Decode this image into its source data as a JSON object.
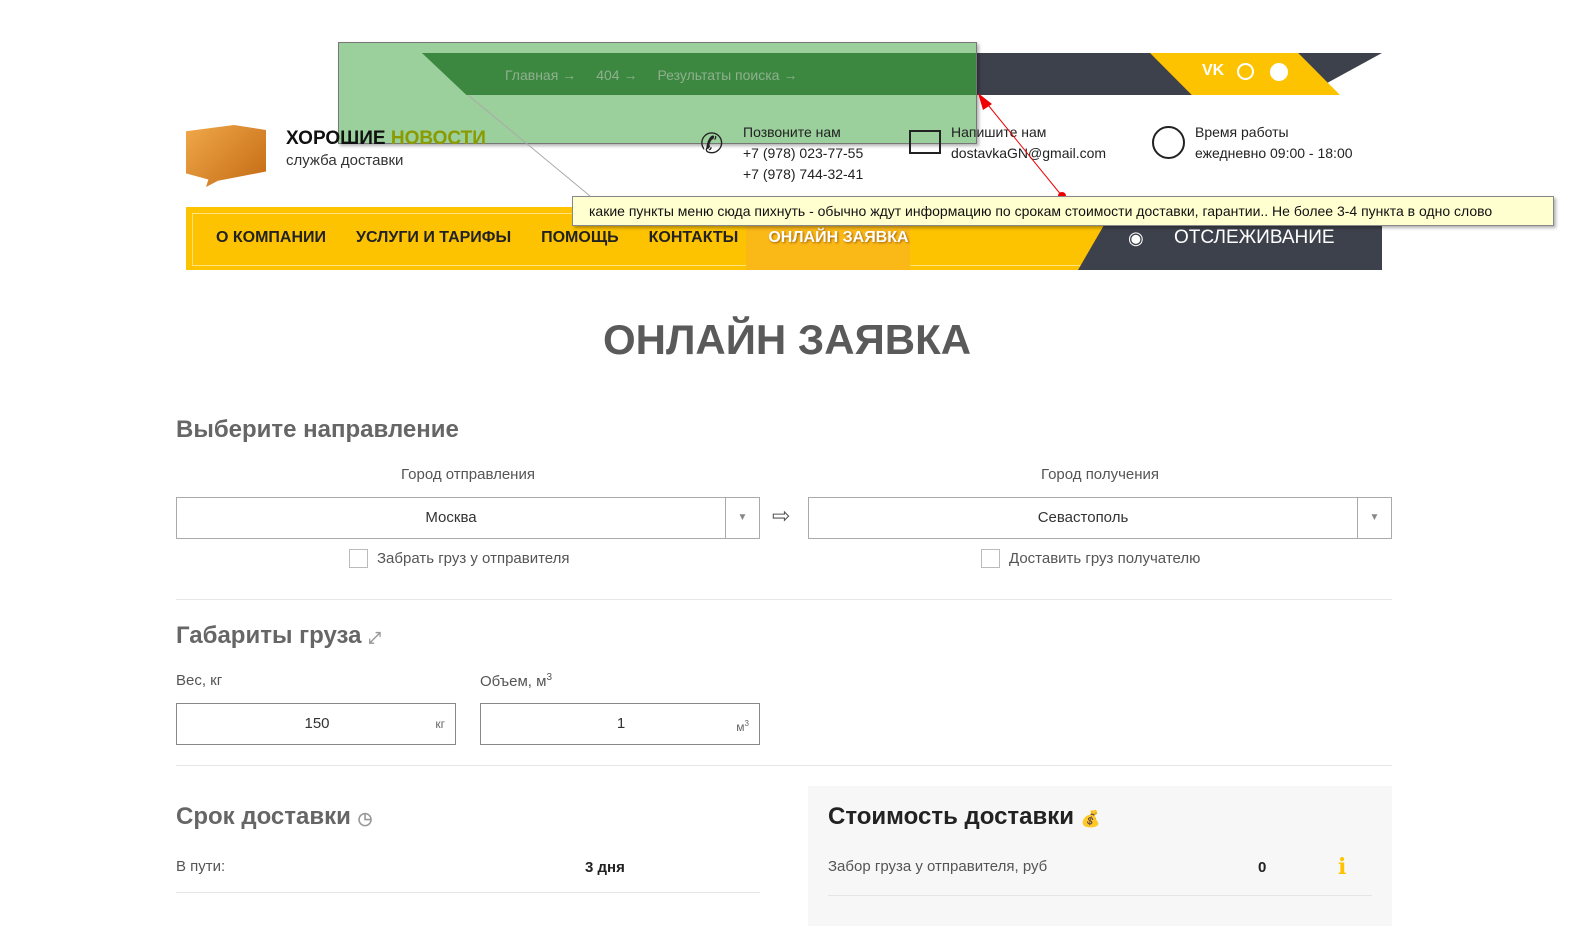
{
  "breadcrumb": [
    "Главная →",
    "404 →",
    "Результаты поиска →"
  ],
  "social": [
    "VK",
    "WA",
    "TG"
  ],
  "logo": {
    "title_a": "ХОРОШИЕ ",
    "title_b": "НОВОСТИ",
    "subtitle": "служба доставки"
  },
  "contacts": {
    "call_label": "Позвоните нам",
    "phone1": "+7 (978) 023-77-55",
    "phone2": "+7 (978) 744-32-41",
    "mail_label": "Напишите нам",
    "email": "dostavkaGN@gmail.com",
    "hours_label": "Время работы",
    "hours": "ежедневно 09:00 - 18:00"
  },
  "nav": [
    "О КОМПАНИИ",
    "УСЛУГИ И ТАРИФЫ",
    "ПОМОЩЬ",
    "КОНТАКТЫ",
    "ОНЛАЙН ЗАЯВКА"
  ],
  "tracking": "ОТСЛЕЖИВАНИЕ",
  "note": "какие пункты меню сюда пихнуть - обычно ждут информацию по срокам стоимости доставки, гарантии.. Не более 3-4 пункта в одно слово",
  "page_title": "ОНЛАЙН ЗАЯВКА",
  "direction": {
    "title": "Выберите направление",
    "from_label": "Город отправления",
    "from_value": "Москва",
    "to_label": "Город получения",
    "to_value": "Севастополь",
    "pickup": "Забрать груз у отправителя",
    "deliver": "Доставить груз получателю"
  },
  "dims": {
    "title": "Габариты груза",
    "weight_label": "Вес, кг",
    "weight": "150",
    "weight_unit": "кг",
    "volume_label": "Объем, м",
    "volume": "1",
    "volume_unit": "м",
    "sup": "3"
  },
  "term": {
    "title": "Срок доставки",
    "transit_label": "В пути:",
    "transit": "3 дня"
  },
  "cost": {
    "title": "Стоимость доставки",
    "pickup_label": "Забор груза у отправителя, руб",
    "pickup_value": "0"
  },
  "colors": {
    "yellow": "#fdc300",
    "dark": "#3d414b"
  }
}
